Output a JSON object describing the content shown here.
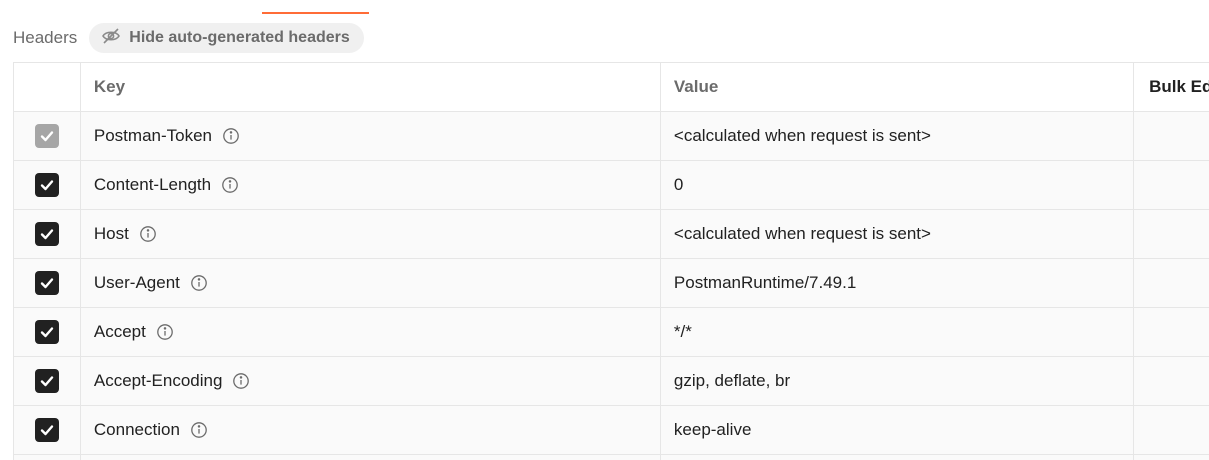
{
  "headers_bar": {
    "title": "Headers",
    "hide_button_label": "Hide auto-generated headers"
  },
  "table": {
    "columns": {
      "key": "Key",
      "value": "Value",
      "bulk_edit": "Bulk Edit"
    },
    "rows": [
      {
        "key": "Postman-Token",
        "value": "<calculated when request is sent>",
        "checked": true,
        "disabled": true
      },
      {
        "key": "Content-Length",
        "value": "0",
        "checked": true,
        "disabled": false
      },
      {
        "key": "Host",
        "value": "<calculated when request is sent>",
        "checked": true,
        "disabled": false
      },
      {
        "key": "User-Agent",
        "value": "PostmanRuntime/7.49.1",
        "checked": true,
        "disabled": false
      },
      {
        "key": "Accept",
        "value": "*/*",
        "checked": true,
        "disabled": false
      },
      {
        "key": "Accept-Encoding",
        "value": "gzip, deflate, br",
        "checked": true,
        "disabled": false
      },
      {
        "key": "Connection",
        "value": "keep-alive",
        "checked": true,
        "disabled": false
      }
    ]
  },
  "colors": {
    "accent": "#ff6c37",
    "checkbox_checked": "#212121",
    "checkbox_disabled": "#a6a6a6",
    "muted_text": "#6b6b6b"
  },
  "icons": {
    "hide_button": "eye-off-icon",
    "row_info": "info-icon",
    "row_checkbox": "check-icon"
  }
}
